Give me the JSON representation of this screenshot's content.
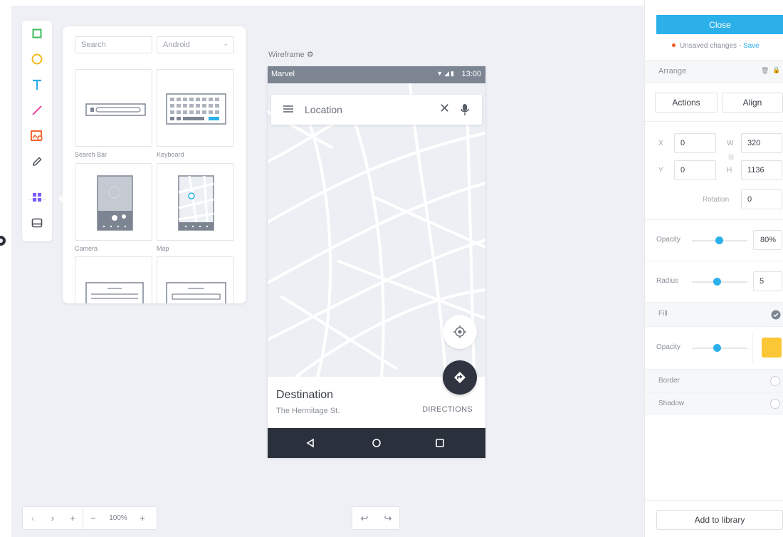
{
  "toolbar": {
    "tools": [
      {
        "icon": "rectangle-icon",
        "color": "#3dbd5d"
      },
      {
        "icon": "ellipse-icon",
        "color": "#f5b81c"
      },
      {
        "icon": "text-icon",
        "color": "#2cb0ea"
      },
      {
        "icon": "line-icon",
        "color": "#e34da0"
      },
      {
        "icon": "image-icon",
        "color": "#f0581e"
      },
      {
        "icon": "pencil-icon",
        "color": "#4a4f57"
      },
      {
        "icon": "library-grid-icon",
        "color": "#7a5af8"
      },
      {
        "icon": "device-icon",
        "color": "#4a4f57"
      }
    ]
  },
  "library": {
    "search_placeholder": "Search",
    "platform_selected": "Android",
    "items": [
      {
        "label": "Search Bar"
      },
      {
        "label": "Keyboard"
      },
      {
        "label": "Camera"
      },
      {
        "label": "Map"
      }
    ]
  },
  "phone": {
    "frame_label": "Wireframe",
    "carrier": "Marvel",
    "time": "13:00",
    "search_placeholder": "Location",
    "destination_title": "Destination",
    "destination_subtitle": "The Hermitage St.",
    "directions_label": "DIRECTIONS"
  },
  "bottom": {
    "zoom": "100%"
  },
  "inspector": {
    "close_label": "Close",
    "unsaved_text": "Unsaved changes - ",
    "save_label": "Save",
    "arrange_label": "Arrange",
    "actions_label": "Actions",
    "align_label": "Align",
    "x_label": "X",
    "x_value": "0",
    "y_label": "Y",
    "y_value": "0",
    "w_label": "W",
    "w_value": "320",
    "h_label": "H",
    "h_value": "1136",
    "rotation_label": "Rotation",
    "rotation_value": "0",
    "opacity_label": "Opacity",
    "opacity_value": "80%",
    "opacity_fraction": 0.8,
    "radius_label": "Radius",
    "radius_value": "5",
    "fill_label": "Fill",
    "fill_opacity_label": "Opacity",
    "fill_color": "#fcc736",
    "border_label": "Border",
    "shadow_label": "Shadow",
    "add_library_label": "Add to library"
  },
  "colors": {
    "accent": "#2cb0ea",
    "unsaved_dot": "#f0581e",
    "dark": "#2b313c"
  }
}
